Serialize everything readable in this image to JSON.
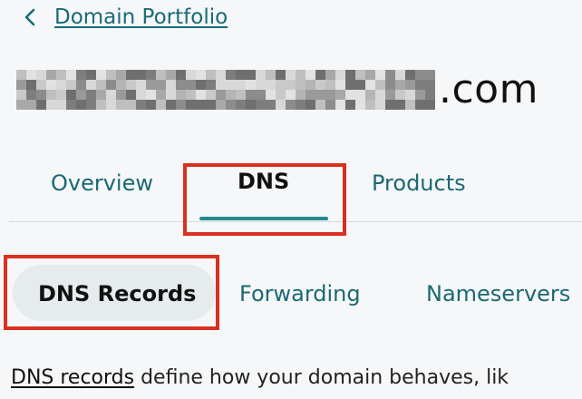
{
  "breadcrumb": {
    "back_icon": "chevron-left-icon",
    "link_label": "Domain Portfolio"
  },
  "domain": {
    "name_redacted": true,
    "tld": ".com"
  },
  "tabs": [
    {
      "label": "Overview",
      "active": false
    },
    {
      "label": "DNS",
      "active": true
    },
    {
      "label": "Products",
      "active": false
    }
  ],
  "subtabs": [
    {
      "label": "DNS Records",
      "active": true
    },
    {
      "label": "Forwarding",
      "active": false
    },
    {
      "label": "Nameservers",
      "active": false
    }
  ],
  "description": {
    "link_text": "DNS records",
    "rest_text": " define how your domain behaves, lik"
  },
  "colors": {
    "accent": "#24878f",
    "link": "#1b6872",
    "highlight": "#d9301f"
  }
}
